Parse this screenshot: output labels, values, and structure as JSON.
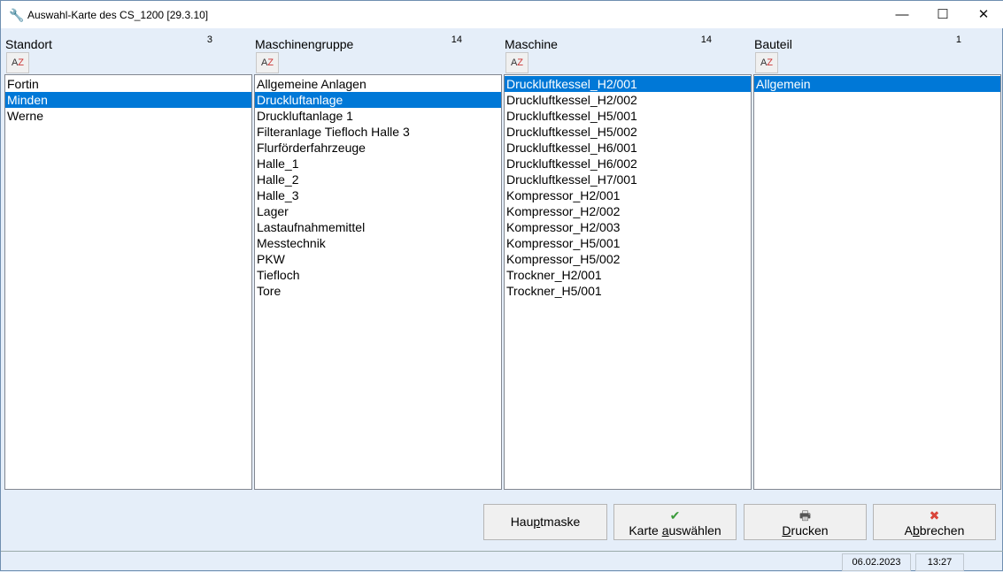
{
  "window": {
    "title": "Auswahl-Karte des CS_1200 [29.3.10]"
  },
  "columns": [
    {
      "label": "Standort",
      "count": "3",
      "items": [
        "Fortin",
        "Minden",
        "Werne"
      ],
      "selected": 1
    },
    {
      "label": "Maschinengruppe",
      "count": "14",
      "items": [
        "Allgemeine Anlagen",
        "Druckluftanlage",
        "Druckluftanlage 1",
        "Filteranlage Tiefloch Halle 3",
        "Flurförderfahrzeuge",
        "Halle_1",
        "Halle_2",
        "Halle_3",
        "Lager",
        "Lastaufnahmemittel",
        "Messtechnik",
        "PKW",
        "Tiefloch",
        "Tore"
      ],
      "selected": 1
    },
    {
      "label": "Maschine",
      "count": "14",
      "items": [
        "Druckluftkessel_H2/001",
        "Druckluftkessel_H2/002",
        "Druckluftkessel_H5/001",
        "Druckluftkessel_H5/002",
        "Druckluftkessel_H6/001",
        "Druckluftkessel_H6/002",
        "Druckluftkessel_H7/001",
        "Kompressor_H2/001",
        "Kompressor_H2/002",
        "Kompressor_H2/003",
        "Kompressor_H5/001",
        "Kompressor_H5/002",
        "Trockner_H2/001",
        "Trockner_H5/001"
      ],
      "selected": 0
    },
    {
      "label": "Bauteil",
      "count": "1",
      "items": [
        "Allgemein"
      ],
      "selected": 0
    }
  ],
  "sort": {
    "a": "A",
    "z": "Z"
  },
  "buttons": {
    "main": {
      "pre": "Hau",
      "key": "p",
      "post": "tmaske"
    },
    "select": {
      "pre": "Karte ",
      "key": "a",
      "post": "uswählen"
    },
    "print": {
      "pre": "",
      "key": "D",
      "post": "rucken"
    },
    "cancel": {
      "pre": "A",
      "key": "b",
      "post": "brechen"
    }
  },
  "status": {
    "date": "06.02.2023",
    "time": "13:27"
  }
}
